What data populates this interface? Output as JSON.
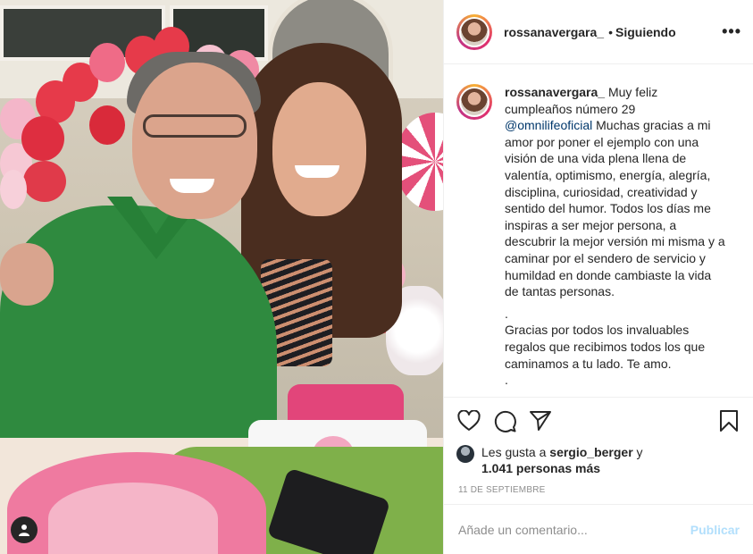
{
  "post": {
    "username": "rossanavergara_",
    "separator": "•",
    "follow_status": "Siguiendo",
    "more_label": "•••"
  },
  "caption": {
    "username": "rossanavergara_",
    "line1": " Muy feliz cumpleaños número 29 ",
    "mention": "@omnilifeoficial",
    "body": " Muchas gracias a mi amor por poner el ejemplo con una visión de una vida plena llena de valentía, optimismo, energía, alegría, disciplina, curiosidad, creatividad y sentido del humor. Todos los días me inspiras a ser mejor persona, a descubrir la mejor versión mi misma y a caminar por el sendero de servicio y humildad en donde cambiaste la vida de tantas personas.",
    "dot1": ".",
    "body2": "Gracias por todos los invaluables regalos que recibimos todos los que caminamos a tu lado. Te amo.",
    "dot2": "."
  },
  "likes": {
    "prefix": "Les gusta a ",
    "user": "sergio_berger",
    "middle": " y",
    "count": "1.041 personas más"
  },
  "date": "11 DE SEPTIEMBRE",
  "comment": {
    "placeholder": "Añade un comentario...",
    "publish_label": "Publicar"
  },
  "icons": {
    "like": "heart-icon",
    "comment": "comment-icon",
    "share": "share-icon",
    "save": "bookmark-icon",
    "tag": "user-tag-icon"
  },
  "colors": {
    "text": "#262626",
    "secondary": "#8e8e8e",
    "publish_disabled": "#b2dffc",
    "mention": "#00376b",
    "border": "#efefef"
  }
}
